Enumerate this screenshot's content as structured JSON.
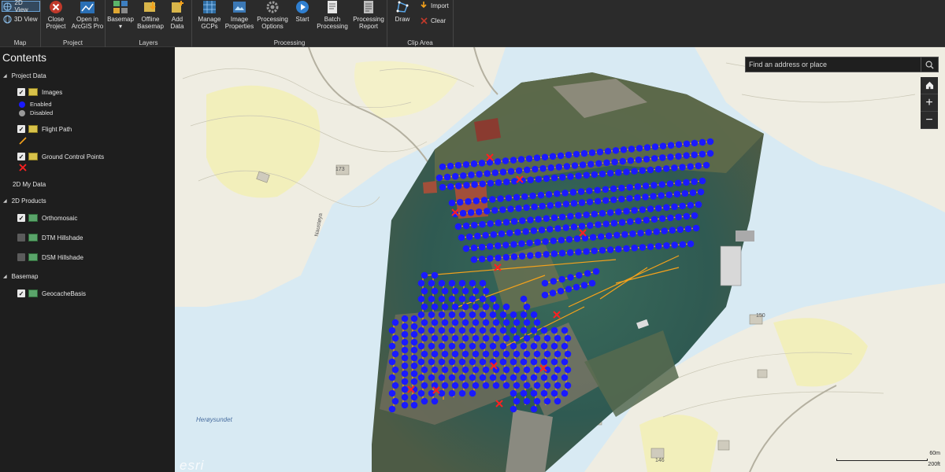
{
  "ribbon": {
    "view_2d": "2D View",
    "view_3d": "3D View",
    "map_group": "Map",
    "project_group": "Project",
    "close_project": "Close\nProject",
    "open_in_arcgis": "Open in\nArcGIS Pro",
    "layers_group": "Layers",
    "basemap": "Basemap\n▾",
    "offline_basemap": "Offline\nBasemap",
    "add_data": "Add\nData",
    "processing_group": "Processing",
    "manage_gcps": "Manage\nGCPs",
    "image_properties": "Image\nProperties",
    "processing_options": "Processing\nOptions",
    "start": "Start",
    "batch_processing": "Batch\nProcessing",
    "processing_report": "Processing\nReport",
    "clip_group": "Clip Area",
    "draw": "Draw",
    "import": "Import",
    "clear": "Clear"
  },
  "sidebar": {
    "title": "Contents",
    "project_data": "Project Data",
    "images": "Images",
    "enabled": "Enabled",
    "disabled": "Disabled",
    "flight_path": "Flight Path",
    "gcp": "Ground Control Points",
    "my_data": "2D My Data",
    "products": "2D Products",
    "orthomosaic": "Orthomosaic",
    "dtm": "DTM Hillshade",
    "dsm": "DSM Hillshade",
    "basemap": "Basemap",
    "geocache": "GeocacheBasis"
  },
  "map": {
    "search_placeholder": "Find an address or place",
    "water_label": "Herøysundet",
    "road_label": "Naustøya",
    "elev_173": "173",
    "elev_150": "150",
    "elev_146": "146",
    "esri": "esri",
    "scale_m": "60m",
    "scale_ft": "200ft"
  },
  "colors": {
    "enabled_dot": "#1a1aff",
    "disabled_dot": "#9a9a9a",
    "flight_path": "#f5a21b",
    "gcp": "#ff2020",
    "water": "#d8eaf3",
    "land": "#efede2",
    "park": "#f2efbb"
  }
}
